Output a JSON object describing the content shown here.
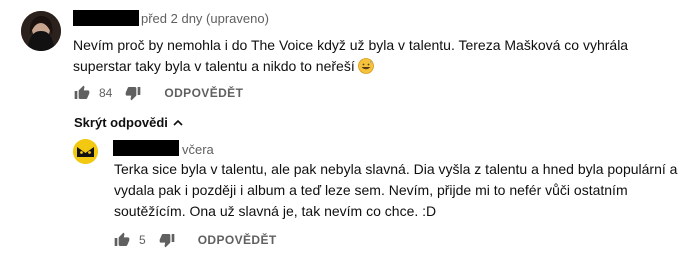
{
  "comment": {
    "time": "před 2 dny (upraveno)",
    "lines": [
      "Nevím proč by nemohla i do The Voice když už byla v talentu. Tereza Mašková co vyhrála",
      "superstar taky byla v talentu a nikdo to neřeší"
    ],
    "emoji": "grinning-sweat-face-emoji",
    "likes": "84",
    "reply_label": "ODPOVĚDĚT"
  },
  "replies_toggle": {
    "label": "Skrýt odpovědi"
  },
  "reply": {
    "time": "včera",
    "lines": [
      "Terka sice byla v talentu, ale pak nebyla slavná. Dia vyšla z talentu a hned byla populární a",
      "vydala pak i později i album a teď leze sem. Nevím, přijde mi to nefér vůči ostatním",
      "soutěžícím. Ona už slavná je, tak nevím co chce. :D"
    ],
    "likes": "5",
    "reply_label": "ODPOVĚDĚT"
  },
  "colors": {
    "secondary_text": "#606060",
    "redaction": "#000000",
    "reply_avatar_bg": "#f2c811"
  }
}
